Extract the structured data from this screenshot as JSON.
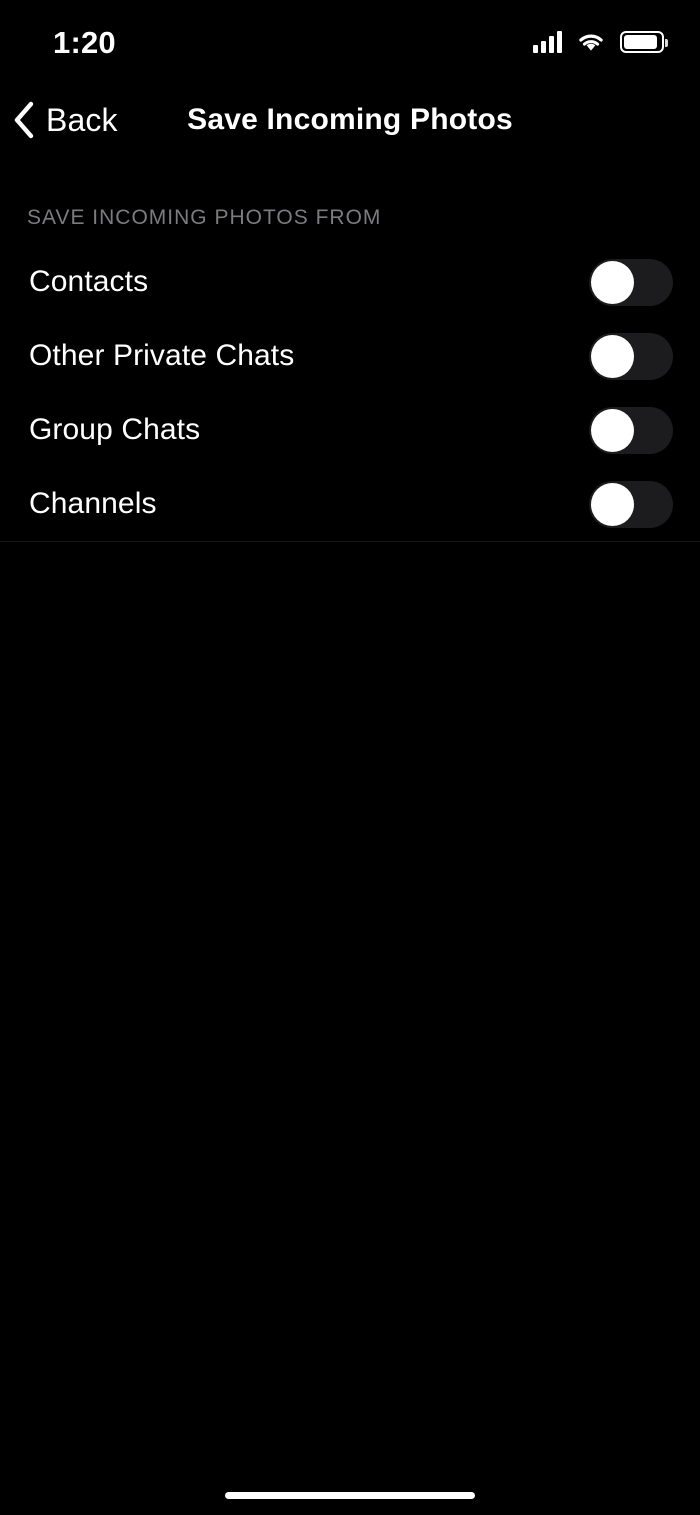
{
  "status_bar": {
    "time": "1:20",
    "signal_icon": "cellular-signal-icon",
    "signal_bars": 4,
    "wifi_icon": "wifi-icon",
    "battery_icon": "battery-icon",
    "battery_level_percent": 92
  },
  "nav": {
    "back_icon": "chevron-left-icon",
    "back_label": "Back",
    "title": "Save Incoming Photos"
  },
  "section": {
    "header": "SAVE INCOMING PHOTOS FROM",
    "rows": [
      {
        "label": "Contacts",
        "toggle_state": "off",
        "toggle_name": "toggle-contacts"
      },
      {
        "label": "Other Private Chats",
        "toggle_state": "off",
        "toggle_name": "toggle-other-private-chats"
      },
      {
        "label": "Group Chats",
        "toggle_state": "off",
        "toggle_name": "toggle-group-chats"
      },
      {
        "label": "Channels",
        "toggle_state": "off",
        "toggle_name": "toggle-channels"
      }
    ]
  },
  "home_indicator": "home-indicator",
  "colors": {
    "background": "#000000",
    "text_primary": "#ffffff",
    "text_secondary": "#7c7c80",
    "toggle_off_track": "#1c1c1e",
    "toggle_knob": "#ffffff",
    "separator": "#161618"
  }
}
